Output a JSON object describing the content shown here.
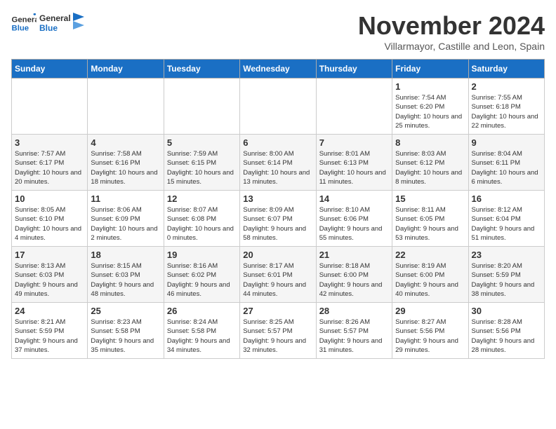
{
  "logo": {
    "general": "General",
    "blue": "Blue"
  },
  "title": "November 2024",
  "subtitle": "Villarmayor, Castille and Leon, Spain",
  "days_of_week": [
    "Sunday",
    "Monday",
    "Tuesday",
    "Wednesday",
    "Thursday",
    "Friday",
    "Saturday"
  ],
  "weeks": [
    [
      {
        "day": "",
        "info": ""
      },
      {
        "day": "",
        "info": ""
      },
      {
        "day": "",
        "info": ""
      },
      {
        "day": "",
        "info": ""
      },
      {
        "day": "",
        "info": ""
      },
      {
        "day": "1",
        "info": "Sunrise: 7:54 AM\nSunset: 6:20 PM\nDaylight: 10 hours and 25 minutes."
      },
      {
        "day": "2",
        "info": "Sunrise: 7:55 AM\nSunset: 6:18 PM\nDaylight: 10 hours and 22 minutes."
      }
    ],
    [
      {
        "day": "3",
        "info": "Sunrise: 7:57 AM\nSunset: 6:17 PM\nDaylight: 10 hours and 20 minutes."
      },
      {
        "day": "4",
        "info": "Sunrise: 7:58 AM\nSunset: 6:16 PM\nDaylight: 10 hours and 18 minutes."
      },
      {
        "day": "5",
        "info": "Sunrise: 7:59 AM\nSunset: 6:15 PM\nDaylight: 10 hours and 15 minutes."
      },
      {
        "day": "6",
        "info": "Sunrise: 8:00 AM\nSunset: 6:14 PM\nDaylight: 10 hours and 13 minutes."
      },
      {
        "day": "7",
        "info": "Sunrise: 8:01 AM\nSunset: 6:13 PM\nDaylight: 10 hours and 11 minutes."
      },
      {
        "day": "8",
        "info": "Sunrise: 8:03 AM\nSunset: 6:12 PM\nDaylight: 10 hours and 8 minutes."
      },
      {
        "day": "9",
        "info": "Sunrise: 8:04 AM\nSunset: 6:11 PM\nDaylight: 10 hours and 6 minutes."
      }
    ],
    [
      {
        "day": "10",
        "info": "Sunrise: 8:05 AM\nSunset: 6:10 PM\nDaylight: 10 hours and 4 minutes."
      },
      {
        "day": "11",
        "info": "Sunrise: 8:06 AM\nSunset: 6:09 PM\nDaylight: 10 hours and 2 minutes."
      },
      {
        "day": "12",
        "info": "Sunrise: 8:07 AM\nSunset: 6:08 PM\nDaylight: 10 hours and 0 minutes."
      },
      {
        "day": "13",
        "info": "Sunrise: 8:09 AM\nSunset: 6:07 PM\nDaylight: 9 hours and 58 minutes."
      },
      {
        "day": "14",
        "info": "Sunrise: 8:10 AM\nSunset: 6:06 PM\nDaylight: 9 hours and 55 minutes."
      },
      {
        "day": "15",
        "info": "Sunrise: 8:11 AM\nSunset: 6:05 PM\nDaylight: 9 hours and 53 minutes."
      },
      {
        "day": "16",
        "info": "Sunrise: 8:12 AM\nSunset: 6:04 PM\nDaylight: 9 hours and 51 minutes."
      }
    ],
    [
      {
        "day": "17",
        "info": "Sunrise: 8:13 AM\nSunset: 6:03 PM\nDaylight: 9 hours and 49 minutes."
      },
      {
        "day": "18",
        "info": "Sunrise: 8:15 AM\nSunset: 6:03 PM\nDaylight: 9 hours and 48 minutes."
      },
      {
        "day": "19",
        "info": "Sunrise: 8:16 AM\nSunset: 6:02 PM\nDaylight: 9 hours and 46 minutes."
      },
      {
        "day": "20",
        "info": "Sunrise: 8:17 AM\nSunset: 6:01 PM\nDaylight: 9 hours and 44 minutes."
      },
      {
        "day": "21",
        "info": "Sunrise: 8:18 AM\nSunset: 6:00 PM\nDaylight: 9 hours and 42 minutes."
      },
      {
        "day": "22",
        "info": "Sunrise: 8:19 AM\nSunset: 6:00 PM\nDaylight: 9 hours and 40 minutes."
      },
      {
        "day": "23",
        "info": "Sunrise: 8:20 AM\nSunset: 5:59 PM\nDaylight: 9 hours and 38 minutes."
      }
    ],
    [
      {
        "day": "24",
        "info": "Sunrise: 8:21 AM\nSunset: 5:59 PM\nDaylight: 9 hours and 37 minutes."
      },
      {
        "day": "25",
        "info": "Sunrise: 8:23 AM\nSunset: 5:58 PM\nDaylight: 9 hours and 35 minutes."
      },
      {
        "day": "26",
        "info": "Sunrise: 8:24 AM\nSunset: 5:58 PM\nDaylight: 9 hours and 34 minutes."
      },
      {
        "day": "27",
        "info": "Sunrise: 8:25 AM\nSunset: 5:57 PM\nDaylight: 9 hours and 32 minutes."
      },
      {
        "day": "28",
        "info": "Sunrise: 8:26 AM\nSunset: 5:57 PM\nDaylight: 9 hours and 31 minutes."
      },
      {
        "day": "29",
        "info": "Sunrise: 8:27 AM\nSunset: 5:56 PM\nDaylight: 9 hours and 29 minutes."
      },
      {
        "day": "30",
        "info": "Sunrise: 8:28 AM\nSunset: 5:56 PM\nDaylight: 9 hours and 28 minutes."
      }
    ]
  ]
}
